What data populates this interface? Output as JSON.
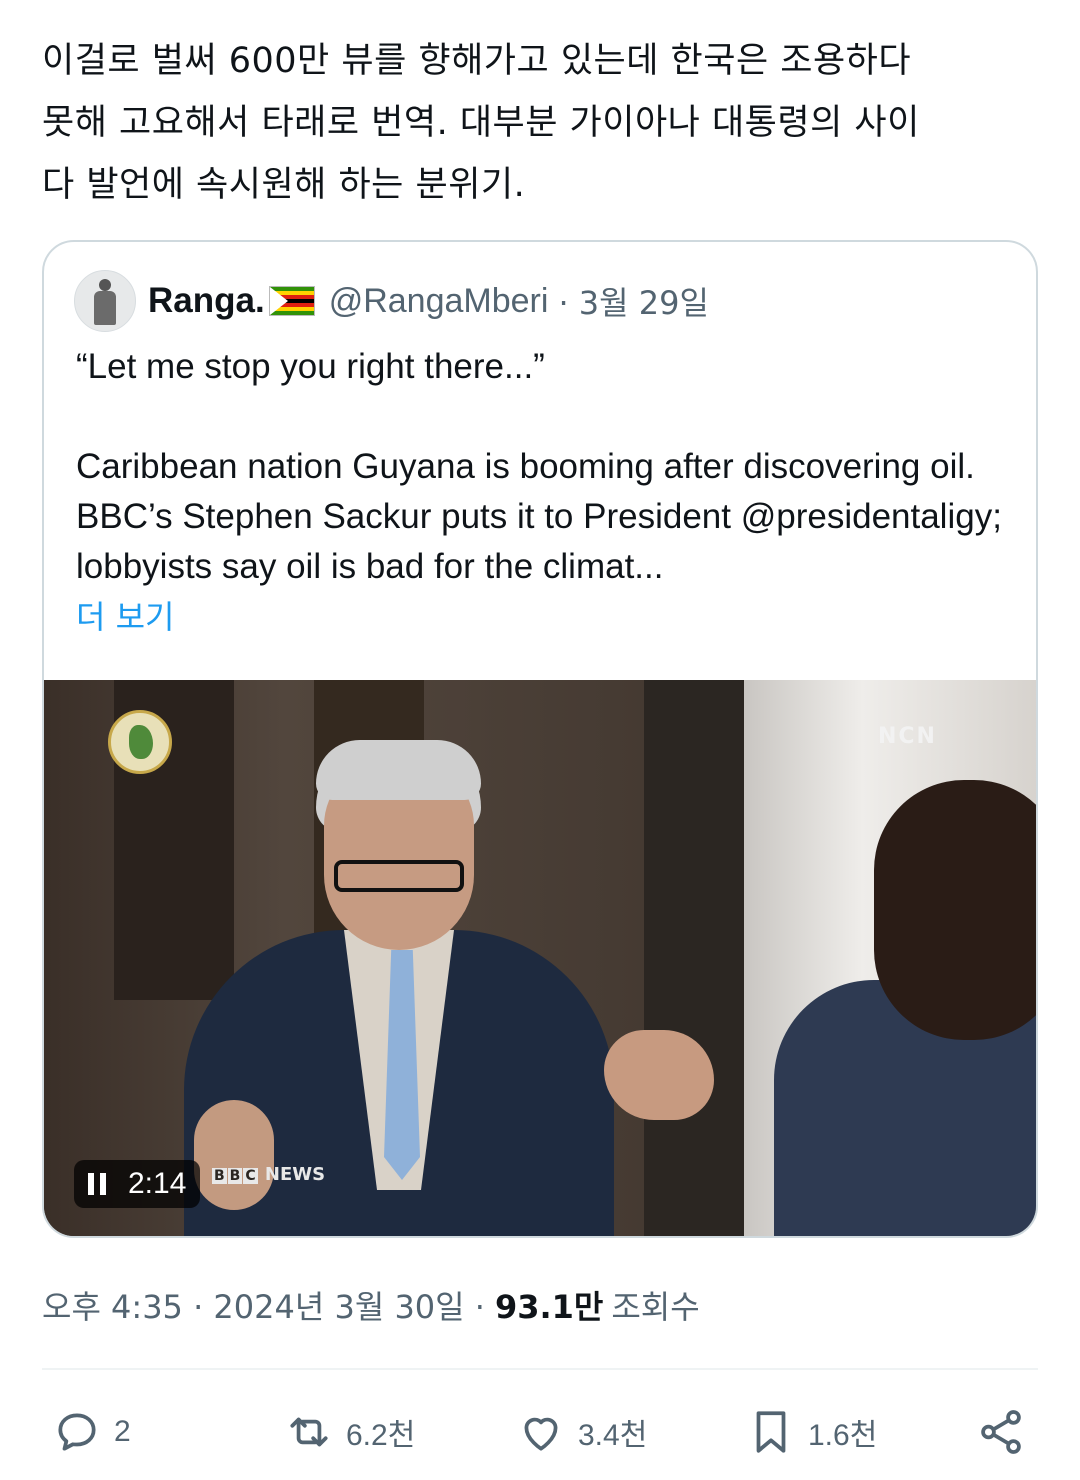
{
  "tweet": {
    "text": "이걸로 벌써 600만 뷰를 향해가고 있는데 한국은 조용하다\n못해 고요해서 타래로 번역. 대부분 가이아나 대통령의 사이\n다 발언에 속시원해 하는 분위기."
  },
  "quote": {
    "name": "Ranga.",
    "handle": "@RangaMberi",
    "date": "· 3월 29일",
    "quote_line": "“Let me stop you right there...”",
    "body": "Caribbean nation Guyana is booming after discovering oil. BBC’s Stephen Sackur puts it to President @presidentaligy; lobbyists say oil is bad for the climat...",
    "more": "더 보기",
    "flag_colors": [
      "#319208",
      "#ffd200",
      "#de2010",
      "#000000",
      "#de2010",
      "#ffd200",
      "#319208"
    ],
    "video": {
      "duration": "2:14",
      "channel_badge": "NCN",
      "bbc_boxes": [
        "B",
        "B",
        "C"
      ],
      "bbc_label": "NEWS"
    }
  },
  "meta": {
    "time": "오후 4:35 · 2024년 3월 30일 ·",
    "views": "93.1만",
    "views_label": "조회수"
  },
  "actions": {
    "reply_count": "2",
    "retweet_count": "6.2천",
    "like_count": "3.4천",
    "bookmark_count": "1.6천"
  },
  "colors": {
    "link": "#1d9bf0",
    "secondary_text": "#536471",
    "border": "#cfd9de"
  }
}
